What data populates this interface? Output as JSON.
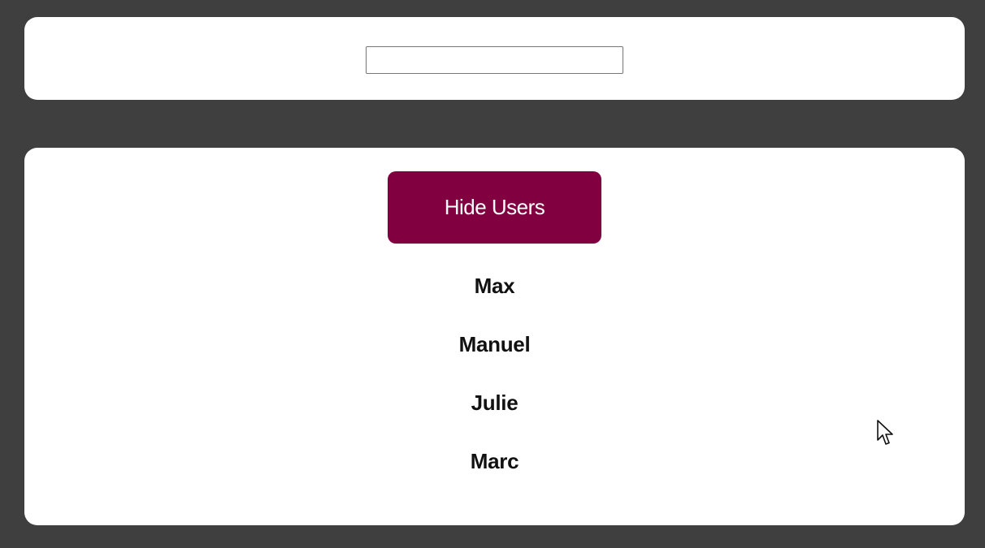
{
  "search": {
    "value": "",
    "placeholder": ""
  },
  "users_panel": {
    "toggle_label": "Hide Users",
    "users": [
      {
        "name": "Max"
      },
      {
        "name": "Manuel"
      },
      {
        "name": "Julie"
      },
      {
        "name": "Marc"
      }
    ]
  },
  "colors": {
    "background": "#3f3f3f",
    "card": "#ffffff",
    "accent": "#810040",
    "text": "#111111"
  },
  "icons": {
    "cursor": "mouse-pointer-icon"
  }
}
